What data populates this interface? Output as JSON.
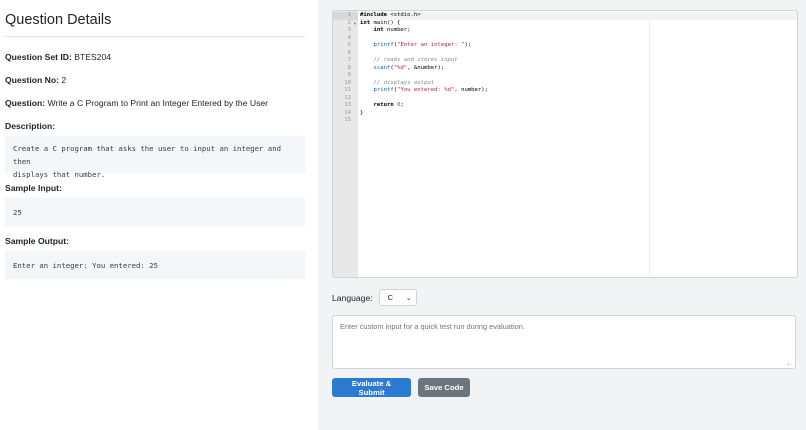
{
  "details": {
    "title": "Question Details",
    "question_set_id_label": "Question Set ID:",
    "question_set_id": "BTES204",
    "question_no_label": "Question No:",
    "question_no": "2",
    "question_label": "Question:",
    "question": "Write a C Program to Print an Integer Entered by the User",
    "description_label": "Description:",
    "description_line1": "Create a C program that asks the user to input an integer and then",
    "description_line2": "displays that number.",
    "sample_input_label": "Sample Input:",
    "sample_input": "25",
    "sample_output_label": "Sample Output:",
    "sample_output": "Enter an integer: You entered: 25"
  },
  "editor": {
    "line_numbers": [
      "1",
      "2",
      "3",
      "4",
      "5",
      "6",
      "7",
      "8",
      "9",
      "10",
      "11",
      "12",
      "13",
      "14",
      "15"
    ],
    "lines": [
      "#include <stdio.h>",
      "int main() {",
      "    int number;",
      "",
      "    printf(\"Enter an integer: \");",
      "",
      "    // reads and stores input",
      "    scanf(\"%d\", &number);",
      "",
      "    // displays output",
      "    printf(\"You entered: %d\", number);",
      "",
      "    return 0;",
      "}",
      ""
    ]
  },
  "controls": {
    "language_label": "Language:",
    "language_value": "C",
    "custom_input_placeholder": "Enter custom input for a quick test run during evaluation.",
    "submit_label": "Evaluate & Submit",
    "save_label": "Save Code"
  },
  "colors": {
    "primary": "#2b7bd1",
    "secondary": "#6c757d",
    "right_panel_bg": "#f1f3f5",
    "code_box_bg": "#f4f7fa"
  }
}
